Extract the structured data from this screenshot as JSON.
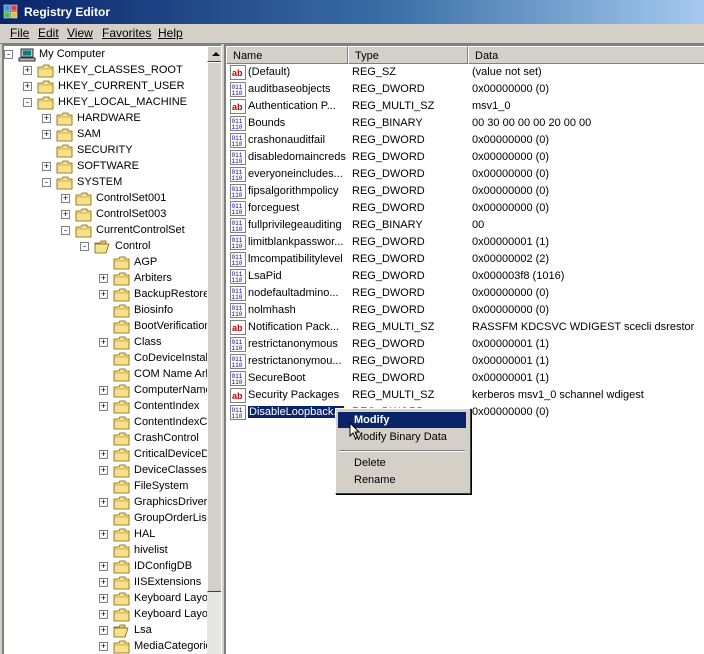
{
  "window": {
    "title": "Registry Editor"
  },
  "menu": [
    "File",
    "Edit",
    "View",
    "Favorites",
    "Help"
  ],
  "tree": [
    {
      "label": "My Computer",
      "depth": 0,
      "exp": "-",
      "icon": "computer"
    },
    {
      "label": "HKEY_CLASSES_ROOT",
      "depth": 1,
      "exp": "+",
      "icon": "folder"
    },
    {
      "label": "HKEY_CURRENT_USER",
      "depth": 1,
      "exp": "+",
      "icon": "folder"
    },
    {
      "label": "HKEY_LOCAL_MACHINE",
      "depth": 1,
      "exp": "-",
      "icon": "folder"
    },
    {
      "label": "HARDWARE",
      "depth": 2,
      "exp": "+",
      "icon": "folder"
    },
    {
      "label": "SAM",
      "depth": 2,
      "exp": "+",
      "icon": "folder"
    },
    {
      "label": "SECURITY",
      "depth": 2,
      "exp": "",
      "icon": "folder"
    },
    {
      "label": "SOFTWARE",
      "depth": 2,
      "exp": "+",
      "icon": "folder"
    },
    {
      "label": "SYSTEM",
      "depth": 2,
      "exp": "-",
      "icon": "folder"
    },
    {
      "label": "ControlSet001",
      "depth": 3,
      "exp": "+",
      "icon": "folder"
    },
    {
      "label": "ControlSet003",
      "depth": 3,
      "exp": "+",
      "icon": "folder"
    },
    {
      "label": "CurrentControlSet",
      "depth": 3,
      "exp": "-",
      "icon": "folder"
    },
    {
      "label": "Control",
      "depth": 4,
      "exp": "-",
      "icon": "folder-open"
    },
    {
      "label": "AGP",
      "depth": 5,
      "exp": "",
      "icon": "folder"
    },
    {
      "label": "Arbiters",
      "depth": 5,
      "exp": "+",
      "icon": "folder"
    },
    {
      "label": "BackupRestore",
      "depth": 5,
      "exp": "+",
      "icon": "folder"
    },
    {
      "label": "Biosinfo",
      "depth": 5,
      "exp": "",
      "icon": "folder"
    },
    {
      "label": "BootVerificationProgram",
      "depth": 5,
      "exp": "",
      "icon": "folder"
    },
    {
      "label": "Class",
      "depth": 5,
      "exp": "+",
      "icon": "folder"
    },
    {
      "label": "CoDeviceInstallers",
      "depth": 5,
      "exp": "",
      "icon": "folder"
    },
    {
      "label": "COM Name Arbiter",
      "depth": 5,
      "exp": "",
      "icon": "folder"
    },
    {
      "label": "ComputerName",
      "depth": 5,
      "exp": "+",
      "icon": "folder"
    },
    {
      "label": "ContentIndex",
      "depth": 5,
      "exp": "+",
      "icon": "folder"
    },
    {
      "label": "ContentIndexCommon",
      "depth": 5,
      "exp": "",
      "icon": "folder"
    },
    {
      "label": "CrashControl",
      "depth": 5,
      "exp": "",
      "icon": "folder"
    },
    {
      "label": "CriticalDeviceDatabase",
      "depth": 5,
      "exp": "+",
      "icon": "folder"
    },
    {
      "label": "DeviceClasses",
      "depth": 5,
      "exp": "+",
      "icon": "folder"
    },
    {
      "label": "FileSystem",
      "depth": 5,
      "exp": "",
      "icon": "folder"
    },
    {
      "label": "GraphicsDrivers",
      "depth": 5,
      "exp": "+",
      "icon": "folder"
    },
    {
      "label": "GroupOrderList",
      "depth": 5,
      "exp": "",
      "icon": "folder"
    },
    {
      "label": "HAL",
      "depth": 5,
      "exp": "+",
      "icon": "folder"
    },
    {
      "label": "hivelist",
      "depth": 5,
      "exp": "",
      "icon": "folder"
    },
    {
      "label": "IDConfigDB",
      "depth": 5,
      "exp": "+",
      "icon": "folder"
    },
    {
      "label": "IISExtensions",
      "depth": 5,
      "exp": "+",
      "icon": "folder"
    },
    {
      "label": "Keyboard Layout",
      "depth": 5,
      "exp": "+",
      "icon": "folder"
    },
    {
      "label": "Keyboard Layouts",
      "depth": 5,
      "exp": "+",
      "icon": "folder"
    },
    {
      "label": "Lsa",
      "depth": 5,
      "exp": "+",
      "icon": "folder-open"
    },
    {
      "label": "MediaCategories",
      "depth": 5,
      "exp": "+",
      "icon": "folder"
    }
  ],
  "columns": [
    "Name",
    "Type",
    "Data"
  ],
  "values": [
    {
      "name": "(Default)",
      "type": "REG_SZ",
      "data": "(value not set)",
      "icon": "ab"
    },
    {
      "name": "auditbaseobjects",
      "type": "REG_DWORD",
      "data": "0x00000000 (0)",
      "icon": "bin"
    },
    {
      "name": "Authentication P...",
      "type": "REG_MULTI_SZ",
      "data": "msv1_0",
      "icon": "ab"
    },
    {
      "name": "Bounds",
      "type": "REG_BINARY",
      "data": "00 30 00 00 00 20 00 00",
      "icon": "bin"
    },
    {
      "name": "crashonauditfail",
      "type": "REG_DWORD",
      "data": "0x00000000 (0)",
      "icon": "bin"
    },
    {
      "name": "disabledomaincreds",
      "type": "REG_DWORD",
      "data": "0x00000000 (0)",
      "icon": "bin"
    },
    {
      "name": "everyoneincludes...",
      "type": "REG_DWORD",
      "data": "0x00000000 (0)",
      "icon": "bin"
    },
    {
      "name": "fipsalgorithmpolicy",
      "type": "REG_DWORD",
      "data": "0x00000000 (0)",
      "icon": "bin"
    },
    {
      "name": "forceguest",
      "type": "REG_DWORD",
      "data": "0x00000000 (0)",
      "icon": "bin"
    },
    {
      "name": "fullprivilegeauditing",
      "type": "REG_BINARY",
      "data": "00",
      "icon": "bin"
    },
    {
      "name": "limitblankpasswor...",
      "type": "REG_DWORD",
      "data": "0x00000001 (1)",
      "icon": "bin"
    },
    {
      "name": "lmcompatibilitylevel",
      "type": "REG_DWORD",
      "data": "0x00000002 (2)",
      "icon": "bin"
    },
    {
      "name": "LsaPid",
      "type": "REG_DWORD",
      "data": "0x000003f8 (1016)",
      "icon": "bin"
    },
    {
      "name": "nodefaultadmino...",
      "type": "REG_DWORD",
      "data": "0x00000000 (0)",
      "icon": "bin"
    },
    {
      "name": "nolmhash",
      "type": "REG_DWORD",
      "data": "0x00000000 (0)",
      "icon": "bin"
    },
    {
      "name": "Notification Pack...",
      "type": "REG_MULTI_SZ",
      "data": "RASSFM KDCSVC WDIGEST scecli dsrestor",
      "icon": "ab"
    },
    {
      "name": "restrictanonymous",
      "type": "REG_DWORD",
      "data": "0x00000001 (1)",
      "icon": "bin"
    },
    {
      "name": "restrictanonymou...",
      "type": "REG_DWORD",
      "data": "0x00000001 (1)",
      "icon": "bin"
    },
    {
      "name": "SecureBoot",
      "type": "REG_DWORD",
      "data": "0x00000001 (1)",
      "icon": "bin"
    },
    {
      "name": "Security Packages",
      "type": "REG_MULTI_SZ",
      "data": "kerberos msv1_0 schannel wdigest",
      "icon": "ab"
    },
    {
      "name": "DisableLoopback...",
      "type": "REG_DWORD",
      "data": "0x00000000 (0)",
      "icon": "bin",
      "selected": true
    }
  ],
  "context_menu": {
    "items": [
      "Modify",
      "Modify Binary Data",
      "Delete",
      "Rename"
    ],
    "highlighted": "Modify"
  }
}
